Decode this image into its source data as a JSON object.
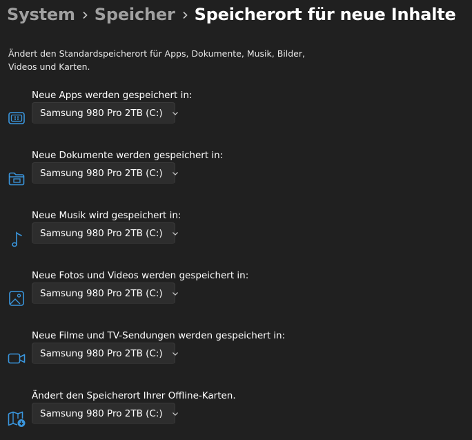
{
  "breadcrumb": {
    "items": [
      "System",
      "Speicher"
    ],
    "current": "Speicherort für neue Inhalte"
  },
  "description": "Ändert den Standardspeicherort für Apps, Dokumente, Musik, Bilder, Videos und Karten.",
  "settings": [
    {
      "label": "Neue Apps werden gespeichert in:",
      "value": "Samsung 980 Pro 2TB (C:)",
      "icon": "apps-icon"
    },
    {
      "label": "Neue Dokumente werden gespeichert in:",
      "value": "Samsung 980 Pro 2TB (C:)",
      "icon": "documents-folder-icon"
    },
    {
      "label": "Neue Musik wird gespeichert in:",
      "value": "Samsung 980 Pro 2TB (C:)",
      "icon": "music-note-icon"
    },
    {
      "label": "Neue Fotos und Videos werden gespeichert in:",
      "value": "Samsung 980 Pro 2TB (C:)",
      "icon": "photo-icon"
    },
    {
      "label": "Neue Filme und TV-Sendungen werden gespeichert in:",
      "value": "Samsung 980 Pro 2TB (C:)",
      "icon": "video-camera-icon"
    },
    {
      "label": "Ändert den Speicherort Ihrer Offline-Karten.",
      "value": "Samsung 980 Pro 2TB (C:)",
      "icon": "offline-map-icon"
    }
  ],
  "colors": {
    "background": "#202020",
    "accent": "#3a96dd",
    "dropdown": "#2d2d2d"
  }
}
